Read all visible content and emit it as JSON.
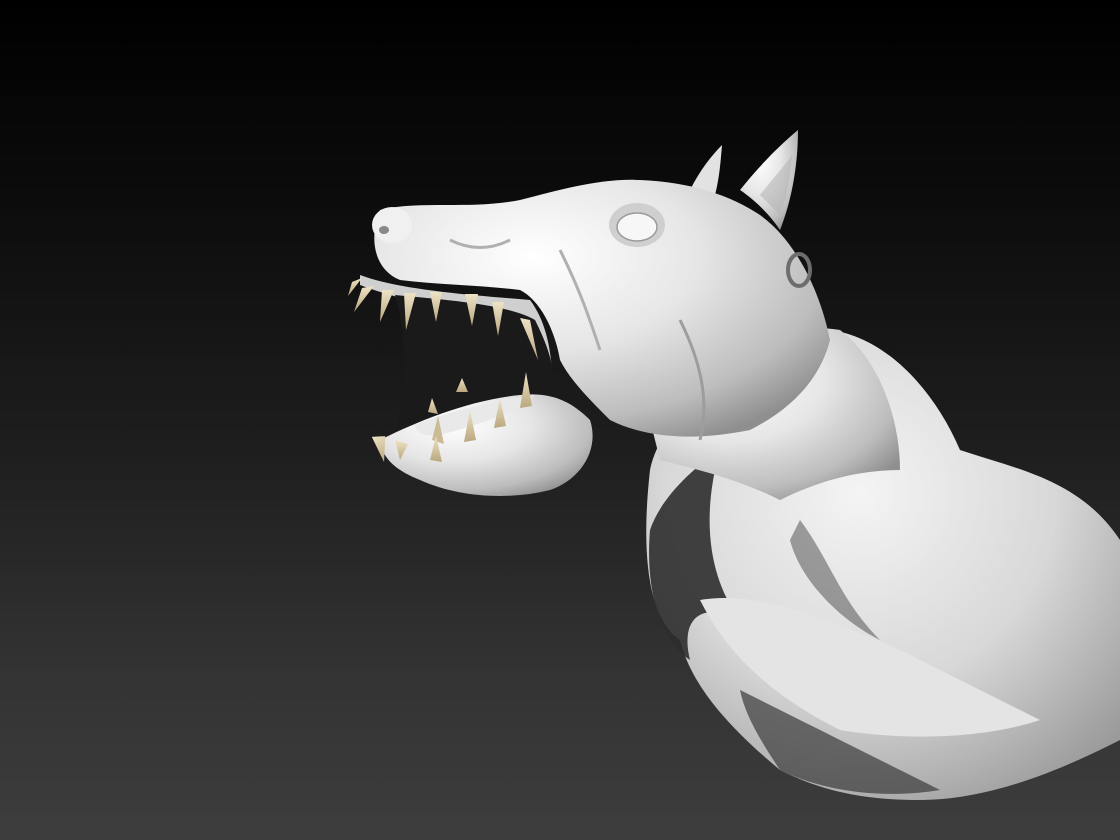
{
  "scene": {
    "subject": "sculpted-creature-bust",
    "icon": "creature-sculpt",
    "colors": {
      "background_top": "#000000",
      "background_bottom": "#3d3d3d",
      "material": "#e8e8e8",
      "material_shadow": "#2a2a2a",
      "teeth": "#d9c9a6",
      "earring": "#6d6d6d",
      "mouth_interior": "#1a1a1a"
    }
  }
}
